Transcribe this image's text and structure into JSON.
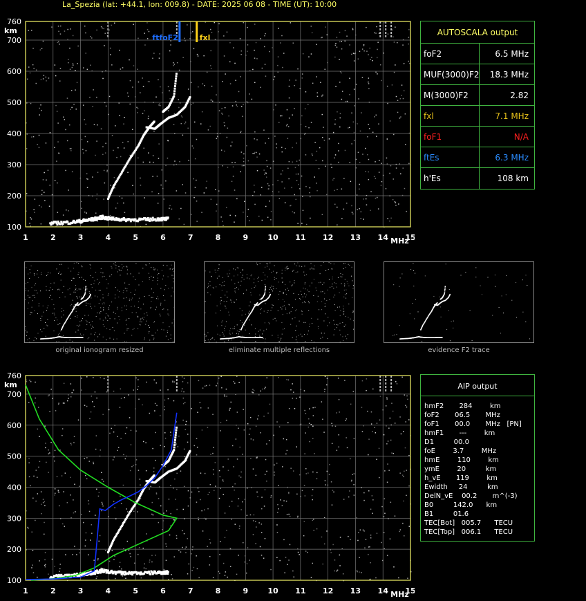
{
  "header": {
    "title": "La_Spezia (lat: +44.1, lon: 009.8) - DATE: 2025 06 08 - TIME (UT): 10:00"
  },
  "colors": {
    "grid": "#777777",
    "axis": "#e0e060",
    "frame": "#3fb33f",
    "fxl": "#ffd21a",
    "foF2": "#1f6fff",
    "foF1": "#ff2020",
    "ftEs": "#2a8cff",
    "profile": "#22dd22",
    "trueHeight": "#1030ff"
  },
  "top_chart": {
    "y_unit": "km",
    "x_unit": "MHz",
    "y_ticks": [
      "760",
      "700",
      "600",
      "500",
      "400",
      "300",
      "200",
      "100"
    ],
    "x_ticks": [
      "1",
      "2",
      "3",
      "4",
      "5",
      "6",
      "7",
      "8",
      "9",
      "10",
      "11",
      "12",
      "13",
      "14",
      "15"
    ],
    "markers": [
      {
        "label": "ftfoF2",
        "freq": 6.3
      },
      {
        "label": "fxl",
        "freq": 7.1
      }
    ]
  },
  "autoscala": {
    "title": "AUTOSCALA output",
    "rows": [
      {
        "key": "foF2",
        "value": "6.5 MHz",
        "color": "#ffffff"
      },
      {
        "key": "MUF(3000)F2",
        "value": "18.3 MHz",
        "color": "#ffffff"
      },
      {
        "key": "M(3000)F2",
        "value": "2.82",
        "color": "#ffffff"
      },
      {
        "key": "fxl",
        "value": "7.1 MHz",
        "color": "#e8c21a"
      },
      {
        "key": "foF1",
        "value": "N/A",
        "color": "#ff2020"
      },
      {
        "key": "ftEs",
        "value": "6.3 MHz",
        "color": "#2a8cff"
      },
      {
        "key": "h'Es",
        "value": "108     km",
        "color": "#ffffff"
      }
    ]
  },
  "thumbnails": [
    {
      "caption": "original ionogram resized"
    },
    {
      "caption": "eliminate multiple reflections"
    },
    {
      "caption": "evidence F2 trace"
    }
  ],
  "aip": {
    "title": "AIP output",
    "lines": [
      "hmF2       284        km",
      "foF2       06.5       MHz",
      "foF1       00.0       MHz   [PN]",
      "hmF1       ---        km",
      "D1         00.0",
      "foE        3.7        MHz",
      "hmE        110        km",
      "ymE        20         km",
      "h_vE       119        km",
      "Ewidth     24         km",
      "DelN_vE    00.2       m^(-3)",
      "B0         142.0      km",
      "B1         01.6",
      "TEC[Bot]   005.7      TECU",
      "TEC[Top]   006.1      TECU"
    ]
  },
  "chart_data": [
    {
      "type": "scatter",
      "title": "",
      "xlabel": "MHz",
      "ylabel": "km",
      "xlim": [
        1,
        15
      ],
      "ylim": [
        100,
        760
      ],
      "series": [
        {
          "name": "",
          "x": [
            1.9,
            2.3,
            2.7,
            3.0,
            3.2,
            3.4,
            3.6,
            3.8,
            4.0,
            4.3,
            4.6,
            5.0,
            5.4,
            5.8,
            6.0,
            6.2
          ],
          "y": [
            106,
            108,
            110,
            113,
            116,
            118,
            122,
            126,
            122,
            120,
            118,
            118,
            118,
            120,
            120,
            120
          ]
        },
        {
          "name": "",
          "x": [
            4.0,
            4.2,
            4.5,
            4.8,
            5.1,
            5.3,
            5.5,
            5.7
          ],
          "y": [
            190,
            230,
            275,
            320,
            360,
            395,
            420,
            440
          ]
        },
        {
          "name": "",
          "x": [
            5.4,
            5.7,
            5.9,
            6.2,
            6.5,
            6.8,
            7.0
          ],
          "y": [
            420,
            415,
            430,
            450,
            460,
            485,
            520
          ]
        },
        {
          "name": "",
          "x": [
            6.0,
            6.2,
            6.4,
            6.5
          ],
          "y": [
            470,
            485,
            520,
            600
          ]
        }
      ]
    },
    {
      "type": "line",
      "title": "",
      "xlabel": "MHz",
      "ylabel": "km",
      "xlim": [
        1,
        15
      ],
      "ylim": [
        100,
        760
      ],
      "series": [
        {
          "name": "",
          "x": [
            1.0,
            1.5,
            2.2,
            3.0,
            4.0,
            5.0,
            6.0,
            6.5,
            6.2,
            5.2,
            4.2,
            3.5,
            2.8,
            2.0,
            1.2
          ],
          "y": [
            730,
            620,
            520,
            455,
            400,
            350,
            310,
            300,
            260,
            220,
            180,
            140,
            115,
            105,
            100
          ]
        },
        {
          "name": "",
          "x": [
            1.0,
            2.0,
            3.0,
            3.5,
            3.7,
            3.9,
            4.2,
            4.5,
            4.8,
            5.1,
            5.4,
            5.7,
            6.0,
            6.3,
            6.5
          ],
          "y": [
            102,
            104,
            110,
            130,
            330,
            325,
            345,
            360,
            372,
            385,
            405,
            430,
            470,
            520,
            640
          ]
        }
      ]
    }
  ]
}
